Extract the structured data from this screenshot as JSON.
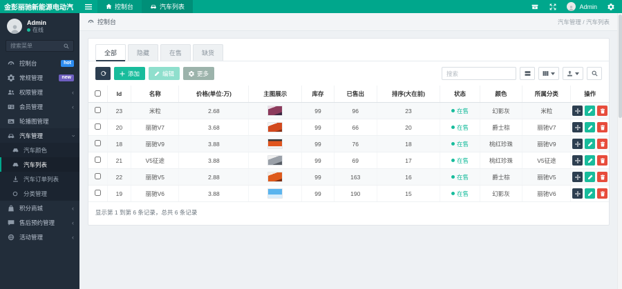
{
  "colors": {
    "theme_green": "#00a78c",
    "sidebar_dark": "#222d3a",
    "badge_hot": "#2d8cf0",
    "badge_new": "#6e5fc0",
    "status_green": "#18bc9c",
    "danger_red": "#e74c3c",
    "navy": "#2c3e50"
  },
  "topbar": {
    "logo": "金彭丽驰新能源电动汽",
    "tabs": [
      {
        "label": "控制台"
      },
      {
        "label": "汽车列表"
      }
    ],
    "username": "Admin"
  },
  "sidebar": {
    "user": {
      "name": "Admin",
      "status": "在线"
    },
    "search_placeholder": "搜索菜单",
    "items": [
      {
        "label": "控制台",
        "badge": "hot"
      },
      {
        "label": "常规管理",
        "badge": "new"
      },
      {
        "label": "权限管理"
      },
      {
        "label": "会员管理"
      },
      {
        "label": "轮播图管理"
      },
      {
        "label": "汽车管理"
      },
      {
        "label": "积分商城"
      },
      {
        "label": "售后预约管理"
      },
      {
        "label": "活动管理"
      }
    ],
    "car_children": [
      {
        "label": "汽车颜色"
      },
      {
        "label": "汽车列表"
      },
      {
        "label": "汽车订单列表"
      },
      {
        "label": "分类管理"
      }
    ]
  },
  "content": {
    "header_title": "控制台",
    "breadcrumb": "汽车管理 / 汽车列表",
    "tabs": [
      "全部",
      "隐藏",
      "在售",
      "缺货"
    ],
    "toolbar": {
      "add": "添加",
      "edit": "编辑",
      "more": "更多",
      "search_placeholder": "搜索"
    },
    "table": {
      "columns": [
        "Id",
        "名称",
        "价格(单位:万)",
        "主图展示",
        "库存",
        "已售出",
        "排序(大在前)",
        "状态",
        "颜色",
        "所属分类",
        "操作"
      ],
      "rows": [
        {
          "id": "23",
          "name": "米粒",
          "price": "2.68",
          "stock": "99",
          "sold": "96",
          "sort": "23",
          "status": "在售",
          "color": "幻影灰",
          "category": "米粒",
          "thumb_style": "background:linear-gradient(160deg,#ecd9e4 22%,#8c3b5c 22% 78%,#3a2740 78%)"
        },
        {
          "id": "20",
          "name": "丽驰V7",
          "price": "3.68",
          "stock": "99",
          "sold": "66",
          "sort": "20",
          "status": "在售",
          "color": "爵士棕",
          "category": "丽驰V7",
          "thumb_style": "background:linear-gradient(160deg,#f4f4f4 25%,#d2491e 25% 82%,#8c2f12 82%)"
        },
        {
          "id": "18",
          "name": "丽驰V9",
          "price": "3.88",
          "stock": "99",
          "sold": "76",
          "sort": "18",
          "status": "在售",
          "color": "桃红珍珠",
          "category": "丽驰V9",
          "thumb_style": "background:linear-gradient(180deg,#3a3a3a 18%,#e0551f 18% 78%,#f0f0f0 78%)"
        },
        {
          "id": "21",
          "name": "V5征途",
          "price": "3.88",
          "stock": "99",
          "sold": "69",
          "sort": "17",
          "status": "在售",
          "color": "桃红珍珠",
          "category": "V5征途",
          "thumb_style": "background:linear-gradient(160deg,#f0f0f0 28%,#9aa0a8 28% 75%,#565c64 75%)"
        },
        {
          "id": "22",
          "name": "丽驰V5",
          "price": "2.88",
          "stock": "99",
          "sold": "163",
          "sort": "16",
          "status": "在售",
          "color": "爵士棕",
          "category": "丽驰V5",
          "thumb_style": "background:linear-gradient(160deg,#f6ece4 24%,#de5a1c 24% 80%,#7e2c10 80%)"
        },
        {
          "id": "19",
          "name": "丽驰V6",
          "price": "3.88",
          "stock": "99",
          "sold": "190",
          "sort": "15",
          "status": "在售",
          "color": "幻影灰",
          "category": "丽驰V6",
          "thumb_style": "background:linear-gradient(180deg,#5ab4ee 62%,#d9edfb 62%)"
        }
      ]
    },
    "footer": "显示第 1 到第 6 条记录，总共 6 条记录"
  }
}
